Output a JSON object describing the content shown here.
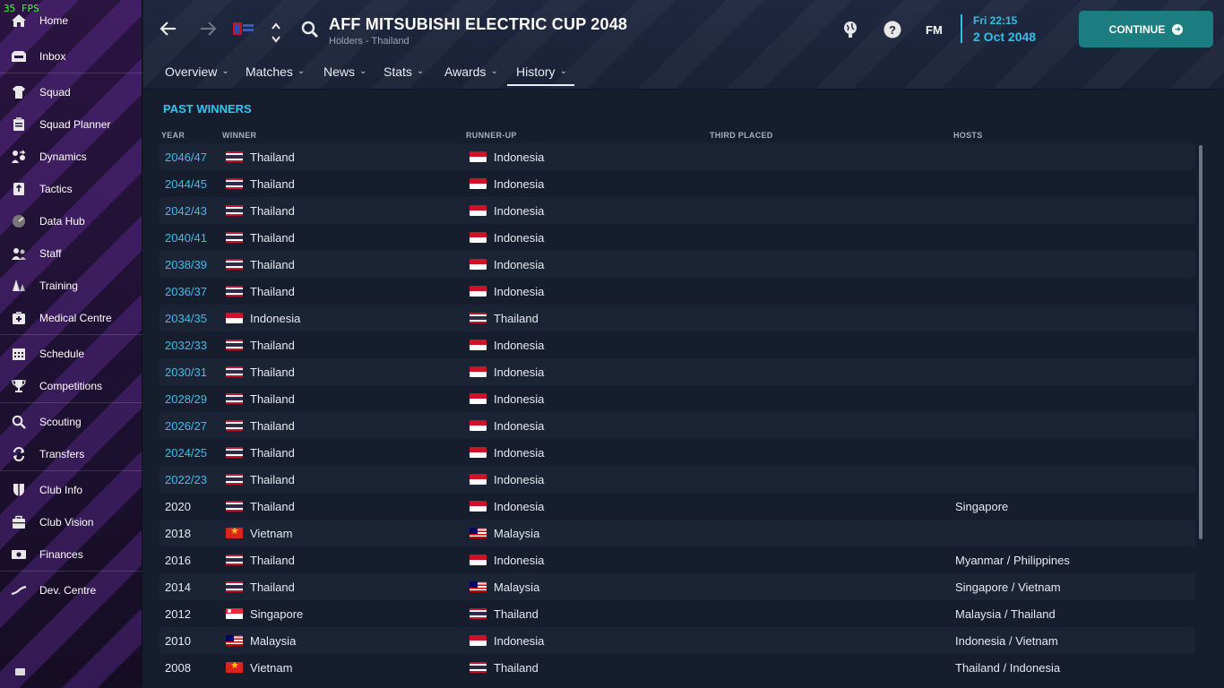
{
  "fps": "35 FPS",
  "sidebar": {
    "items": [
      {
        "label": "Home",
        "icon": "home-icon"
      },
      {
        "label": "Inbox",
        "icon": "inbox-icon"
      },
      {
        "label": "Squad",
        "icon": "shirt-icon"
      },
      {
        "label": "Squad Planner",
        "icon": "clipboard-icon"
      },
      {
        "label": "Dynamics",
        "icon": "people-arrows-icon"
      },
      {
        "label": "Tactics",
        "icon": "tactics-board-icon"
      },
      {
        "label": "Data Hub",
        "icon": "gauge-icon"
      },
      {
        "label": "Staff",
        "icon": "staff-icon"
      },
      {
        "label": "Training",
        "icon": "cones-icon"
      },
      {
        "label": "Medical Centre",
        "icon": "medical-kit-icon"
      },
      {
        "label": "Schedule",
        "icon": "calendar-icon"
      },
      {
        "label": "Competitions",
        "icon": "trophy-icon"
      },
      {
        "label": "Scouting",
        "icon": "magnifier-icon"
      },
      {
        "label": "Transfers",
        "icon": "transfer-arrows-icon"
      },
      {
        "label": "Club Info",
        "icon": "shield-icon"
      },
      {
        "label": "Club Vision",
        "icon": "briefcase-icon"
      },
      {
        "label": "Finances",
        "icon": "money-icon"
      },
      {
        "label": "Dev. Centre",
        "icon": "growth-icon"
      }
    ]
  },
  "header": {
    "title": "AFF MITSUBISHI ELECTRIC CUP 2048",
    "subtitle": "Holders - Thailand",
    "tabs": [
      {
        "label": "Overview"
      },
      {
        "label": "Matches"
      },
      {
        "label": "News"
      },
      {
        "label": "Stats"
      },
      {
        "label": "Awards"
      },
      {
        "label": "History",
        "active": true
      }
    ],
    "date_day": "Fri 22:15",
    "date_full": "2 Oct 2048",
    "continue_label": "CONTINUE",
    "fm_label": "FM"
  },
  "past_winners": {
    "title": "PAST WINNERS",
    "columns": {
      "year": "YEAR",
      "winner": "WINNER",
      "runner_up": "RUNNER-UP",
      "third": "THIRD PLACED",
      "hosts": "HOSTS"
    },
    "rows": [
      {
        "year": "2046/47",
        "link": true,
        "winner": "Thailand",
        "winner_flag": "thailand",
        "runner_up": "Indonesia",
        "runner_flag": "indonesia",
        "hosts": ""
      },
      {
        "year": "2044/45",
        "link": true,
        "winner": "Thailand",
        "winner_flag": "thailand",
        "runner_up": "Indonesia",
        "runner_flag": "indonesia",
        "hosts": ""
      },
      {
        "year": "2042/43",
        "link": true,
        "winner": "Thailand",
        "winner_flag": "thailand",
        "runner_up": "Indonesia",
        "runner_flag": "indonesia",
        "hosts": ""
      },
      {
        "year": "2040/41",
        "link": true,
        "winner": "Thailand",
        "winner_flag": "thailand",
        "runner_up": "Indonesia",
        "runner_flag": "indonesia",
        "hosts": ""
      },
      {
        "year": "2038/39",
        "link": true,
        "winner": "Thailand",
        "winner_flag": "thailand",
        "runner_up": "Indonesia",
        "runner_flag": "indonesia",
        "hosts": ""
      },
      {
        "year": "2036/37",
        "link": true,
        "winner": "Thailand",
        "winner_flag": "thailand",
        "runner_up": "Indonesia",
        "runner_flag": "indonesia",
        "hosts": ""
      },
      {
        "year": "2034/35",
        "link": true,
        "winner": "Indonesia",
        "winner_flag": "indonesia",
        "runner_up": "Thailand",
        "runner_flag": "thailand",
        "hosts": ""
      },
      {
        "year": "2032/33",
        "link": true,
        "winner": "Thailand",
        "winner_flag": "thailand",
        "runner_up": "Indonesia",
        "runner_flag": "indonesia",
        "hosts": ""
      },
      {
        "year": "2030/31",
        "link": true,
        "winner": "Thailand",
        "winner_flag": "thailand",
        "runner_up": "Indonesia",
        "runner_flag": "indonesia",
        "hosts": ""
      },
      {
        "year": "2028/29",
        "link": true,
        "winner": "Thailand",
        "winner_flag": "thailand",
        "runner_up": "Indonesia",
        "runner_flag": "indonesia",
        "hosts": ""
      },
      {
        "year": "2026/27",
        "link": true,
        "winner": "Thailand",
        "winner_flag": "thailand",
        "runner_up": "Indonesia",
        "runner_flag": "indonesia",
        "hosts": ""
      },
      {
        "year": "2024/25",
        "link": true,
        "winner": "Thailand",
        "winner_flag": "thailand",
        "runner_up": "Indonesia",
        "runner_flag": "indonesia",
        "hosts": ""
      },
      {
        "year": "2022/23",
        "link": true,
        "winner": "Thailand",
        "winner_flag": "thailand",
        "runner_up": "Indonesia",
        "runner_flag": "indonesia",
        "hosts": ""
      },
      {
        "year": "2020",
        "link": false,
        "winner": "Thailand",
        "winner_flag": "thailand",
        "runner_up": "Indonesia",
        "runner_flag": "indonesia",
        "hosts": "Singapore"
      },
      {
        "year": "2018",
        "link": false,
        "winner": "Vietnam",
        "winner_flag": "vietnam",
        "runner_up": "Malaysia",
        "runner_flag": "malaysia",
        "hosts": ""
      },
      {
        "year": "2016",
        "link": false,
        "winner": "Thailand",
        "winner_flag": "thailand",
        "runner_up": "Indonesia",
        "runner_flag": "indonesia",
        "hosts": "Myanmar / Philippines"
      },
      {
        "year": "2014",
        "link": false,
        "winner": "Thailand",
        "winner_flag": "thailand",
        "runner_up": "Malaysia",
        "runner_flag": "malaysia",
        "hosts": "Singapore / Vietnam"
      },
      {
        "year": "2012",
        "link": false,
        "winner": "Singapore",
        "winner_flag": "singapore",
        "runner_up": "Thailand",
        "runner_flag": "thailand",
        "hosts": "Malaysia / Thailand"
      },
      {
        "year": "2010",
        "link": false,
        "winner": "Malaysia",
        "winner_flag": "malaysia",
        "runner_up": "Indonesia",
        "runner_flag": "indonesia",
        "hosts": "Indonesia / Vietnam"
      },
      {
        "year": "2008",
        "link": false,
        "winner": "Vietnam",
        "winner_flag": "vietnam",
        "runner_up": "Thailand",
        "runner_flag": "thailand",
        "hosts": "Thailand / Indonesia"
      }
    ]
  },
  "colors": {
    "accent": "#2fc8ee",
    "continue_bg": "#1b7d80",
    "link": "#35c1ea"
  }
}
